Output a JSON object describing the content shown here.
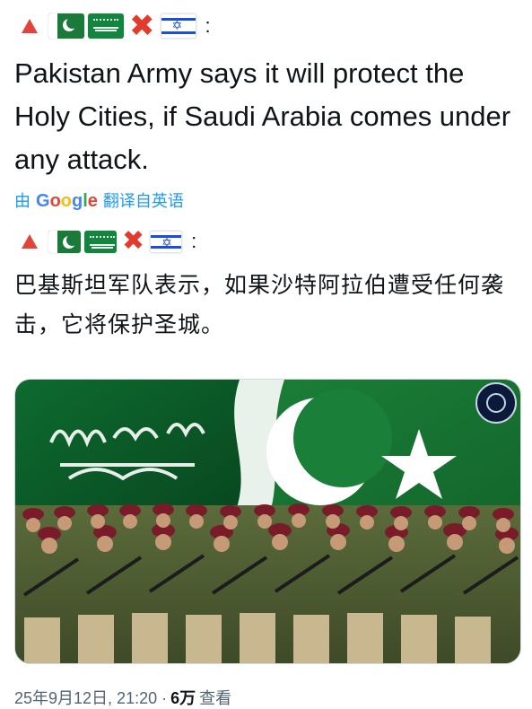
{
  "header_emojis": {
    "top": [
      "red-triangle-icon",
      "pakistan-flag-icon",
      "saudi-flag-icon",
      "cross-mark-icon",
      "israel-flag-icon"
    ],
    "colon": ":"
  },
  "post": {
    "text_en": "Pakistan Army says it will protect the Holy Cities, if Saudi Arabia comes under any attack.",
    "translate_prefix": "由",
    "translate_brand": "Google",
    "translate_suffix": "翻译自英语",
    "text_zh": "巴基斯坦军队表示，如果沙特阿拉伯遭受任何袭击，它将保护圣城。"
  },
  "meta": {
    "date_time": "25年9月12日, 21:20 ·",
    "views_count": "6万",
    "views_label": "查看"
  },
  "colors": {
    "accent": "#1d9bf0",
    "text": "#0f1419",
    "muted": "#536471"
  }
}
